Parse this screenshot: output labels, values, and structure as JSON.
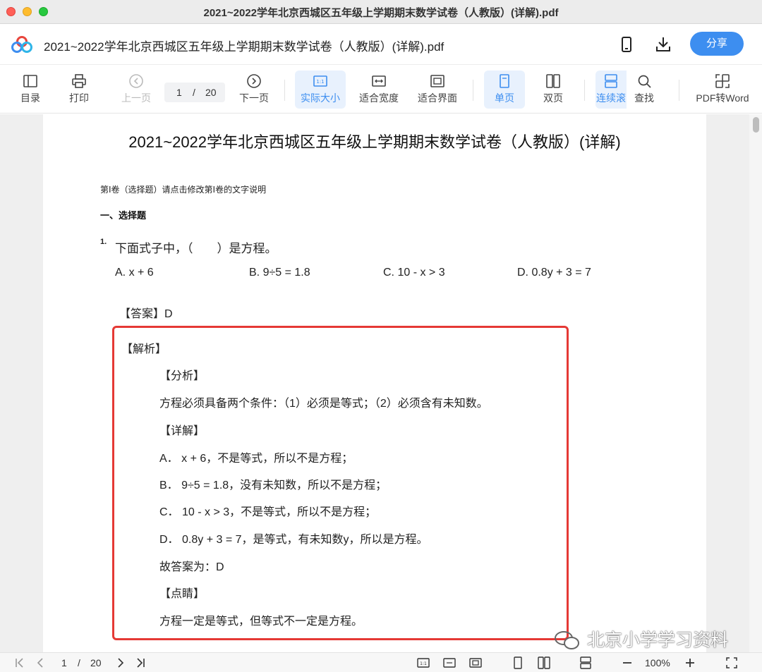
{
  "window": {
    "title": "2021~2022学年北京西城区五年级上学期期末数学试卷（人教版）(详解).pdf"
  },
  "header": {
    "doc_title": "2021~2022学年北京西城区五年级上学期期末数学试卷（人教版）(详解).pdf",
    "share_label": "分享",
    "icons": [
      "app-logo-icon",
      "phone-icon",
      "download-icon"
    ]
  },
  "toolbar": {
    "toc": "目录",
    "print": "打印",
    "prev_page": "上一页",
    "page_current": "1",
    "page_sep": "/",
    "page_total": "20",
    "next_page": "下一页",
    "actual_size": "实际大小",
    "fit_width": "适合宽度",
    "fit_page": "适合界面",
    "single_page": "单页",
    "double_page": "双页",
    "continuous": "连续滚",
    "find": "查找",
    "pdf_to_word": "PDF转Word"
  },
  "document": {
    "title": "2021~2022学年北京西城区五年级上学期期末数学试卷（人教版）(详解)",
    "note": "第Ⅰ卷（选择题）请点击修改第Ⅰ卷的文字说明",
    "section": "一、选择题",
    "question": {
      "number": "1.",
      "stem": "下面式子中，（　　）是方程。",
      "options": [
        "A. x + 6",
        "B. 9÷5 = 1.8",
        "C. 10 - x > 3",
        "D. 0.8y + 3 = 7"
      ],
      "answer": "【答案】D"
    },
    "analysis": {
      "heading": "【解析】",
      "lines": [
        "【分析】",
        "方程必须具备两个条件：（1）必须是等式；（2）必须含有未知数。",
        "【详解】",
        "A． x + 6，不是等式，所以不是方程；",
        "B． 9÷5 = 1.8，没有未知数，所以不是方程；",
        "C． 10 - x > 3，不是等式，所以不是方程；",
        "D． 0.8y + 3 = 7，是等式，有未知数y，所以是方程。",
        "故答案为：D",
        "【点睛】",
        "方程一定是等式，但等式不一定是方程。"
      ]
    },
    "highlight_color": "#e53935"
  },
  "watermark": "北京小学学习资料",
  "statusbar": {
    "page_current": "1",
    "page_sep": "/",
    "page_total": "20",
    "zoom": "100%"
  },
  "colors": {
    "accent": "#3d8ef0",
    "active_bg": "#e8f1fd"
  }
}
